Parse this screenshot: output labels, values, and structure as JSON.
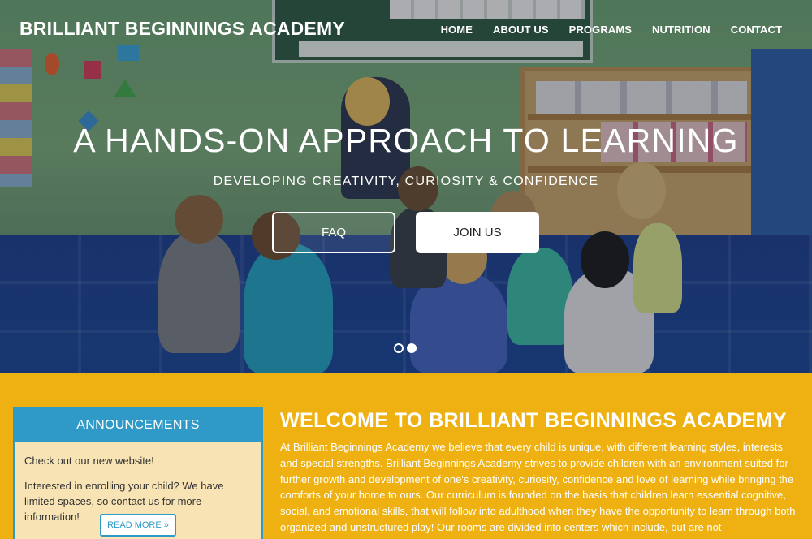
{
  "header": {
    "site_title": "BRILLIANT BEGINNINGS ACADEMY",
    "nav": [
      "HOME",
      "ABOUT US",
      "PROGRAMS",
      "NUTRITION",
      "CONTACT"
    ]
  },
  "hero": {
    "title": "A HANDS-ON APPROACH TO LEARNING",
    "subtitle": "DEVELOPING CREATIVITY, CURIOSITY & CONFIDENCE",
    "faq_label": "FAQ",
    "join_label": "JOIN US",
    "slides_count": 2,
    "active_slide": 2
  },
  "announcements": {
    "heading": "ANNOUNCEMENTS",
    "items": [
      "Check out our new website!",
      "Interested in enrolling your child? We have limited spaces, so contact us for more information!"
    ],
    "read_more": "READ MORE »"
  },
  "welcome": {
    "title": "WELCOME TO BRILLIANT BEGINNINGS ACADEMY",
    "body": "At Brilliant Beginnings Academy we believe that every child is unique, with different learning styles, interests and special strengths. Brilliant Beginnings Academy strives to provide children with an environment suited for further growth and development of one's creativity, curiosity, confidence and love of learning while bringing the comforts of your home to ours. Our curriculum is founded on the basis that children learn essential cognitive, social, and emotional skills, that will follow into adulthood when they have the opportunity to learn through both organized and unstructured play! Our rooms are divided into centers which include, but are not"
  },
  "colors": {
    "accent_yellow": "#eeb111",
    "accent_blue": "#2f9ac8",
    "announce_bg": "#f7e3b4"
  }
}
